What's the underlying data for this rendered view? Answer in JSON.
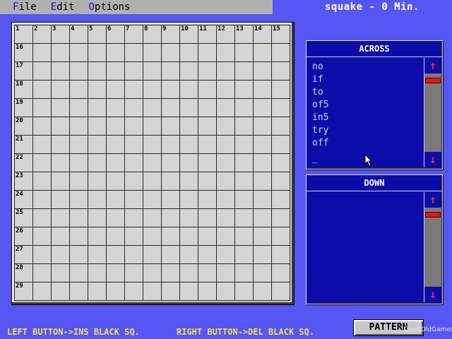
{
  "menu": {
    "items": [
      {
        "hot": "F",
        "rest": "ile"
      },
      {
        "hot": "E",
        "rest": "dit"
      },
      {
        "hot": "O",
        "rest": "ptions"
      }
    ]
  },
  "app_title": "squake - 0 Min.",
  "grid": {
    "columns": 15,
    "rows": 15,
    "column_numbers": [
      "1",
      "2",
      "3",
      "4",
      "5",
      "6",
      "7",
      "8",
      "9",
      "10",
      "11",
      "12",
      "13",
      "14",
      "15"
    ],
    "row_numbers": [
      "16",
      "17",
      "18",
      "19",
      "20",
      "21",
      "22",
      "23",
      "24",
      "25",
      "26",
      "27",
      "28",
      "29"
    ]
  },
  "across": {
    "header": "ACROSS",
    "items": [
      "no",
      "if",
      "to",
      "of5",
      "in5",
      "try",
      "off",
      "_"
    ]
  },
  "down": {
    "header": "DOWN",
    "items": []
  },
  "scroll": {
    "up_icon": "arrow-up-icon",
    "down_icon": "arrow-down-icon"
  },
  "status": {
    "left": "LEFT BUTTON->INS BLACK SQ.",
    "right": "RIGHT BUTTON->DEL BLACK SQ."
  },
  "pattern_button": "PATTERN",
  "watermark": "GoodOldGames.com"
}
